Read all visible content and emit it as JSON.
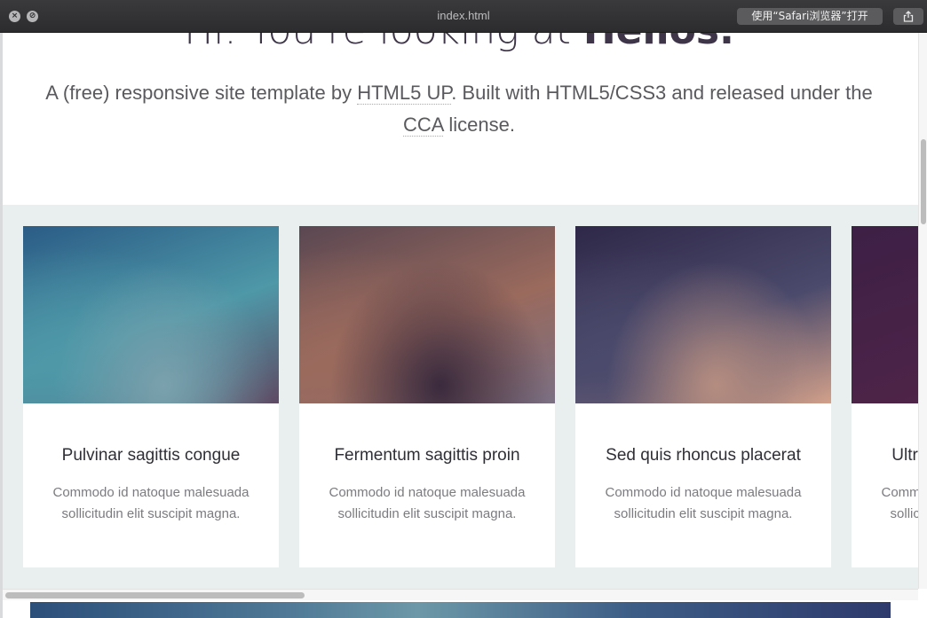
{
  "window": {
    "title": "index.html",
    "open_in_safari_label": "使用“Safari浏览器”打开",
    "close_glyph": "×",
    "block_glyph": "⊘"
  },
  "hero": {
    "title_prefix": "Hi. You're looking at ",
    "title_strong": "Helios.",
    "text_before": "A (free) responsive site template by ",
    "link_html5up": "HTML5 UP",
    "text_middle": ". Built with HTML5/CSS3 and released under the ",
    "link_cca": "CCA",
    "text_after": " license."
  },
  "carousel": {
    "cards": [
      {
        "title": "Pulvinar sagittis congue",
        "text": "Commodo id natoque malesuada sollicitudin elit suscipit magna.",
        "colors": [
          "#2b5c86",
          "#4e98a8",
          "#7aa1ad",
          "#5e4a63"
        ]
      },
      {
        "title": "Fermentum sagittis proin",
        "text": "Commodo id natoque malesuada sollicitudin elit suscipit magna.",
        "colors": [
          "#5a4752",
          "#9a6a5d",
          "#3a2a3d",
          "#7a6f83"
        ]
      },
      {
        "title": "Sed quis rhoncus placerat",
        "text": "Commodo id natoque malesuada sollicitudin elit suscipit magna.",
        "colors": [
          "#2f2848",
          "#4b4a6c",
          "#b58d80",
          "#d2a08a"
        ]
      },
      {
        "title": "Ultrices urna sit lobortis",
        "text": "Commodo id natoque malesuada sollicitudin elit suscipit magna.",
        "colors": [
          "#3d1f45",
          "#54264a"
        ]
      }
    ]
  },
  "theme": {
    "titlebar_bg": "#2c2c2e",
    "heading_color": "#3e3548",
    "section_bg": "#e9eeee"
  }
}
